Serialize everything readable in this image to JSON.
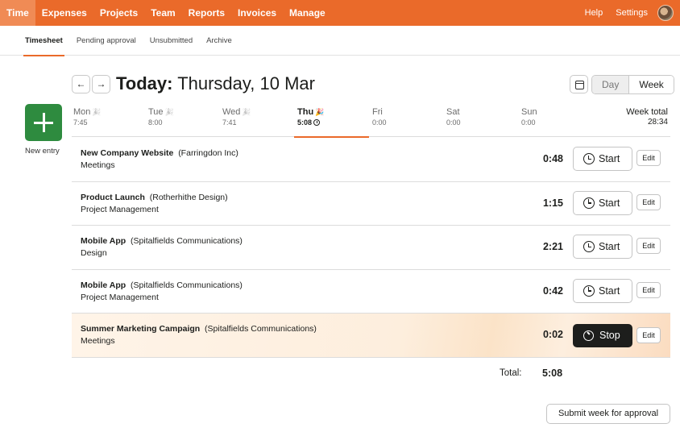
{
  "topnav": {
    "items": [
      "Time",
      "Expenses",
      "Projects",
      "Team",
      "Reports",
      "Invoices",
      "Manage"
    ],
    "help": "Help",
    "settings": "Settings"
  },
  "subnav": {
    "items": [
      "Timesheet",
      "Pending approval",
      "Unsubmitted",
      "Archive"
    ]
  },
  "header": {
    "prev": "←",
    "next": "→",
    "title_bold": "Today:",
    "title_rest": " Thursday, 10 Mar",
    "view_day": "Day",
    "view_week": "Week"
  },
  "new_entry": {
    "label": "New entry"
  },
  "days": [
    {
      "name": "Mon",
      "value": "7:45",
      "party": "🎉"
    },
    {
      "name": "Tue",
      "value": "8:00",
      "party": "🎉"
    },
    {
      "name": "Wed",
      "value": "7:41",
      "party": "🎉"
    },
    {
      "name": "Thu",
      "value": "5:08",
      "party": "🎉"
    },
    {
      "name": "Fri",
      "value": "0:00"
    },
    {
      "name": "Sat",
      "value": "0:00"
    },
    {
      "name": "Sun",
      "value": "0:00"
    }
  ],
  "week_total": {
    "label": "Week total",
    "value": "28:34"
  },
  "entries": [
    {
      "project": "New Company Website",
      "client": "(Farringdon Inc)",
      "task": "Meetings",
      "time": "0:48",
      "action": "Start",
      "edit": "Edit"
    },
    {
      "project": "Product Launch",
      "client": "(Rotherhithe Design)",
      "task": "Project Management",
      "time": "1:15",
      "action": "Start",
      "edit": "Edit"
    },
    {
      "project": "Mobile App",
      "client": "(Spitalfields Communications)",
      "task": "Design",
      "time": "2:21",
      "action": "Start",
      "edit": "Edit"
    },
    {
      "project": "Mobile App",
      "client": "(Spitalfields Communications)",
      "task": "Project Management",
      "time": "0:42",
      "action": "Start",
      "edit": "Edit"
    },
    {
      "project": "Summer Marketing Campaign",
      "client": "(Spitalfields Communications)",
      "task": "Meetings",
      "time": "0:02",
      "action": "Stop",
      "edit": "Edit"
    }
  ],
  "total": {
    "label": "Total:",
    "value": "5:08"
  },
  "submit": {
    "label": "Submit week for approval"
  },
  "colors": {
    "brand": "#ea6a2a",
    "new_entry": "#2e8b3f",
    "stop": "#1d1e1c"
  }
}
